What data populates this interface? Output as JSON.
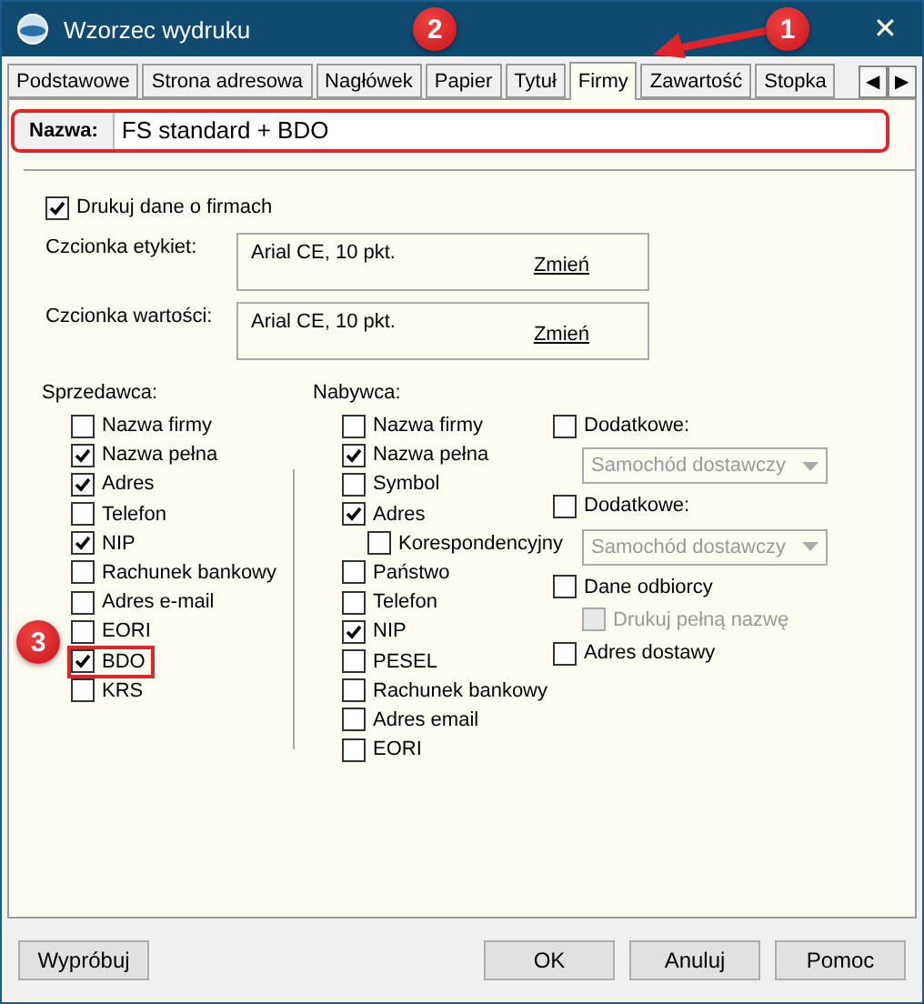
{
  "window": {
    "title": "Wzorzec wydruku",
    "close": "✕"
  },
  "tabs": [
    {
      "label": "Podstawowe",
      "selected": false
    },
    {
      "label": "Strona adresowa",
      "selected": false
    },
    {
      "label": "Nagłówek",
      "selected": false
    },
    {
      "label": "Papier",
      "selected": false
    },
    {
      "label": "Tytuł",
      "selected": false
    },
    {
      "label": "Firmy",
      "selected": true
    },
    {
      "label": "Zawartość",
      "selected": false
    },
    {
      "label": "Stopka",
      "selected": false
    }
  ],
  "tab_scroll": [
    "◀",
    "▶"
  ],
  "name_field": {
    "label": "Nazwa:",
    "value": "FS standard + BDO",
    "highlighted": true
  },
  "print_companies": {
    "label": "Drukuj dane o firmach",
    "checked": true
  },
  "fonts": [
    {
      "label": "Czcionka etykiet:",
      "value": "Arial CE, 10 pkt.",
      "link": "Zmień"
    },
    {
      "label": "Czcionka wartości:",
      "value": "Arial CE, 10 pkt.",
      "link": "Zmień"
    }
  ],
  "seller": {
    "title": "Sprzedawca:",
    "items": [
      {
        "label": "Nazwa firmy",
        "checked": false,
        "highlighted": false
      },
      {
        "label": "Nazwa pełna",
        "checked": true,
        "highlighted": false
      },
      {
        "label": "Adres",
        "checked": true,
        "highlighted": false
      },
      {
        "label": "Telefon",
        "checked": false,
        "highlighted": false
      },
      {
        "label": "NIP",
        "checked": true,
        "highlighted": false
      },
      {
        "label": "Rachunek bankowy",
        "checked": false,
        "highlighted": false
      },
      {
        "label": "Adres e-mail",
        "checked": false,
        "highlighted": false
      },
      {
        "label": "EORI",
        "checked": false,
        "highlighted": false
      },
      {
        "label": "BDO",
        "checked": true,
        "highlighted": true
      },
      {
        "label": "KRS",
        "checked": false,
        "highlighted": false
      }
    ]
  },
  "buyer": {
    "title": "Nabywca:",
    "items": [
      {
        "label": "Nazwa firmy",
        "checked": false
      },
      {
        "label": "Nazwa pełna",
        "checked": true
      },
      {
        "label": "Symbol",
        "checked": false
      },
      {
        "label": "Adres",
        "checked": true,
        "children": [
          {
            "label": "Korespondencyjny",
            "checked": false
          }
        ]
      },
      {
        "label": "Państwo",
        "checked": false
      },
      {
        "label": "Telefon",
        "checked": false
      },
      {
        "label": "NIP",
        "checked": true
      },
      {
        "label": "PESEL",
        "checked": false
      },
      {
        "label": "Rachunek bankowy",
        "checked": false
      },
      {
        "label": "Adres email",
        "checked": false
      },
      {
        "label": "EORI",
        "checked": false
      }
    ]
  },
  "extras": [
    {
      "kind": "select",
      "label": "Dodatkowe:",
      "checked": false,
      "select": {
        "value": "Samochód dostawczy",
        "disabled": true
      }
    },
    {
      "kind": "select",
      "label": "Dodatkowe:",
      "checked": false,
      "select": {
        "value": "Samochód dostawczy",
        "disabled": true
      }
    },
    {
      "kind": "check",
      "label": "Dane odbiorcy",
      "checked": false,
      "children": [
        {
          "label": "Drukuj pełną nazwę",
          "checked": false,
          "disabled": true
        }
      ]
    },
    {
      "kind": "check",
      "label": "Adres dostawy",
      "checked": false
    }
  ],
  "buttons": [
    {
      "label": "Wypróbuj",
      "kind": "left"
    },
    {
      "label": "OK",
      "kind": "right"
    },
    {
      "label": "Anuluj",
      "kind": "right"
    },
    {
      "label": "Pomoc",
      "kind": "right"
    }
  ],
  "annotations": [
    {
      "number": "1",
      "kind": "arrow"
    },
    {
      "number": "2",
      "kind": "badge"
    },
    {
      "number": "3",
      "kind": "badge"
    }
  ]
}
